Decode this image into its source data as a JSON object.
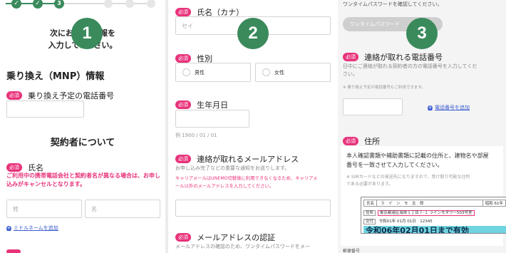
{
  "colors": {
    "accent_green": "#3a8a5c",
    "required_pink": "#e8327a",
    "link_blue": "#3a5bd0"
  },
  "markers": [
    "1",
    "2",
    "3"
  ],
  "panel1": {
    "steps": [
      "3"
    ],
    "intro_title": "次にお客様情報を入力してください。",
    "intro_line1": "次にお",
    "intro_line1b": "情報を",
    "intro_line2": "入力して",
    "intro_line2b": "さい。",
    "mnp_heading": "乗り換え（MNP）情報",
    "required": "必須",
    "mnp_phone_label": "乗り換え予定の電話番号",
    "contractor_heading": "契約者について",
    "name_label": "氏名",
    "name_warning_line1": "ご利用中の携帯電話会社と契約者名が異なる場合は、お申し",
    "name_warning_line2": "込みがキャンセルとなります。",
    "last_name_placeholder": "姓",
    "first_name_placeholder": "名",
    "middle_name_link": "ミドルネームを追加"
  },
  "panel2": {
    "required": "必須",
    "kana_label": "氏名（カナ）",
    "kana_placeholder": "セイ",
    "gender_label": "性別",
    "gender_options": [
      "男性",
      "女性"
    ],
    "birth_label": "生年月日",
    "birth_hint": "例 1900 / 01 / 01",
    "email_label": "連絡が取れるメールアドレス",
    "email_desc": "お申し込み完了などの重要な通知をお送りします。",
    "email_warning_line1": "キャリアメールはUNEMO切替後に利用できなくなるため、キャリアメ",
    "email_warning_line2": "ール以外のメールアドレスを入力してください。",
    "email_confirm_label": "メールアドレスの認証",
    "email_confirm_desc": "メールアドレスの確認のため、ワンタイムパスワードをメー"
  },
  "panel3": {
    "otp_desc": "ワンタイムパスワードを確認してください。",
    "otp_button": "ワンタイムパスワード",
    "required": "必須",
    "phone_label": "連絡が取れる電話番号",
    "phone_desc_line1": "日中にご連絡が取れる契約者の方の電話番号を入力してくだ",
    "phone_desc_line2": "さい。",
    "phone_note": "※ 乗り換え予定の電話番号もご利用できます。",
    "add_phone_link": "電話番号を追加",
    "address_label": "住所",
    "address_desc_line1": "本人確認書類や補助書類に記載の住所と、建物名や部屋",
    "address_desc_line2": "番号を一致させて入力してください。",
    "sim_note_line1": "※ SIMカードなどの発送先になりますので、受け取り可能な住所",
    "sim_note_line2": "である必要があります。",
    "card_name_label": "氏名",
    "card_name_chars": "ラ　イ　ン　モ　太　郎",
    "card_birth": "昭和 61年",
    "card_address_label": "住所",
    "card_address": "東京都港区海岸１丁目７-１ ラインモタワー503号室",
    "card_issue_label": "交付",
    "card_issue": "令和01年 01月 01日　12345",
    "card_expiry": "令和06年02月01日まで有効",
    "postal_label": "郵便番号"
  }
}
